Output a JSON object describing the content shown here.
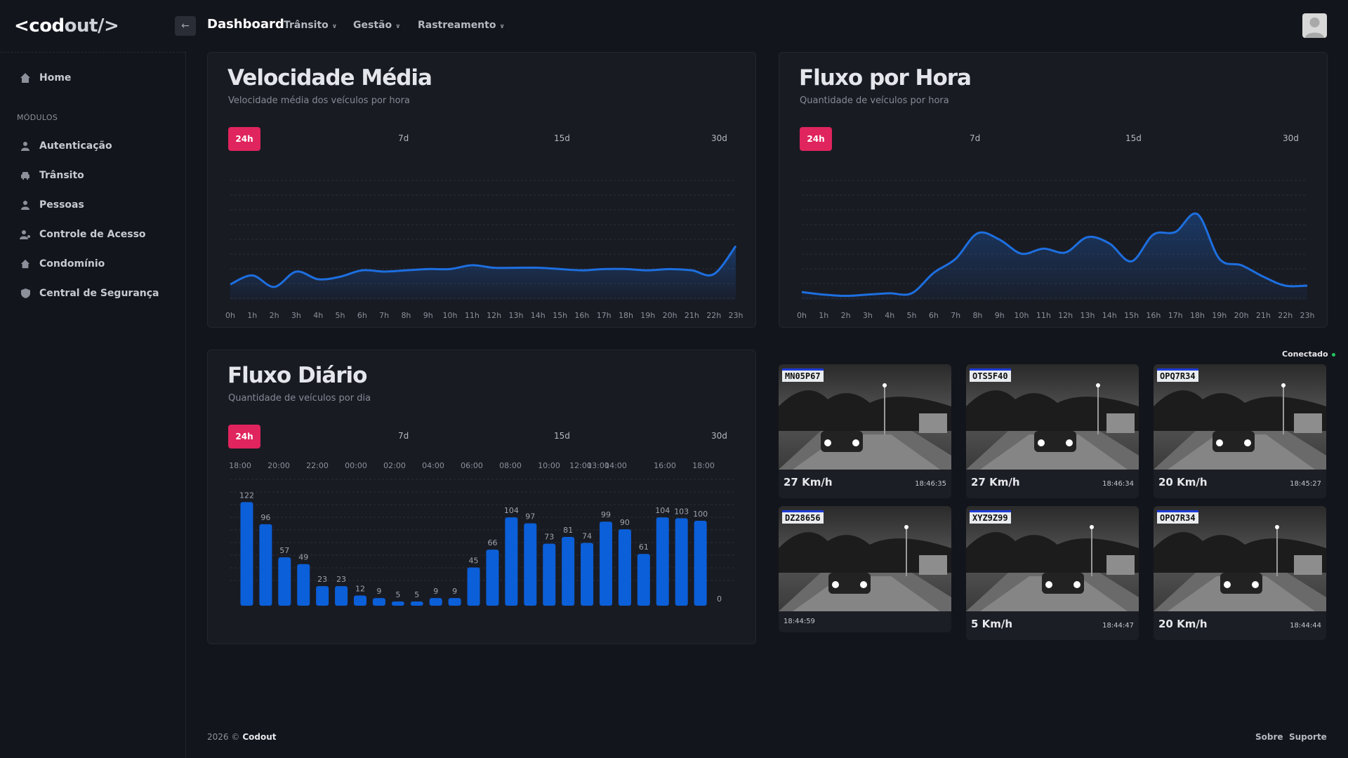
{
  "brand": {
    "logo_left": "<cod",
    "logo_right": "out/>"
  },
  "header": {
    "back_icon": "arrow-left-icon",
    "title": "Dashboard",
    "nav": [
      "Trânsito",
      "Gestão",
      "Rastreamento"
    ]
  },
  "sidebar": {
    "home": "Home",
    "section_label": "MÓDULOS",
    "items": [
      "Autenticação",
      "Trânsito",
      "Pessoas",
      "Controle de Acesso",
      "Condomínio",
      "Central de Segurança"
    ],
    "icons": [
      "user-icon",
      "car-icon",
      "person-icon",
      "user-key-icon",
      "home-icon",
      "shield-icon"
    ]
  },
  "ranges": [
    "24h",
    "7d",
    "15d",
    "30d"
  ],
  "velocidade": {
    "title": "Velocidade Média",
    "subtitle": "Velocidade média dos veículos por hora"
  },
  "fluxo_hora": {
    "title": "Fluxo por Hora",
    "subtitle": "Quantidade de veículos por hora"
  },
  "fluxo_diario": {
    "title": "Fluxo Diário",
    "subtitle": "Quantidade de veículos por dia",
    "zero_label": "0"
  },
  "chart_data": [
    {
      "type": "area",
      "title": "Velocidade Média",
      "x": [
        "0h",
        "1h",
        "2h",
        "3h",
        "4h",
        "5h",
        "6h",
        "7h",
        "8h",
        "9h",
        "10h",
        "11h",
        "12h",
        "13h",
        "14h",
        "15h",
        "16h",
        "17h",
        "18h",
        "19h",
        "20h",
        "21h",
        "22h",
        "23h"
      ],
      "values": [
        12,
        19,
        10,
        22,
        16,
        18,
        23,
        22,
        23,
        24,
        24,
        27,
        25,
        25,
        25,
        24,
        23,
        24,
        24,
        23,
        24,
        23,
        20,
        42
      ],
      "ylim": [
        0,
        100
      ],
      "color": "#1d6fe0"
    },
    {
      "type": "area",
      "title": "Fluxo por Hora",
      "x": [
        "0h",
        "1h",
        "2h",
        "3h",
        "4h",
        "5h",
        "6h",
        "7h",
        "8h",
        "9h",
        "10h",
        "11h",
        "12h",
        "13h",
        "14h",
        "15h",
        "16h",
        "17h",
        "18h",
        "19h",
        "20h",
        "21h",
        "22h",
        "23h"
      ],
      "values": [
        6,
        4,
        3,
        4,
        5,
        5,
        21,
        32,
        52,
        47,
        36,
        40,
        37,
        49,
        44,
        30,
        51,
        53,
        67,
        32,
        27,
        18,
        11,
        11
      ],
      "ylim": [
        0,
        100
      ],
      "color": "#1d6fe0"
    },
    {
      "type": "bar",
      "title": "Fluxo Diário",
      "tick_labels": [
        "18:00",
        "20:00",
        "22:00",
        "00:00",
        "02:00",
        "04:00",
        "06:00",
        "08:00",
        "10:00",
        "12:00",
        "13:00",
        "14:00",
        "16:00",
        "18:00"
      ],
      "values": [
        122,
        96,
        57,
        49,
        23,
        23,
        12,
        9,
        5,
        5,
        9,
        9,
        45,
        66,
        104,
        97,
        73,
        81,
        74,
        99,
        90,
        61,
        104,
        103,
        100,
        0
      ],
      "ylim": [
        0,
        200
      ],
      "color": "#0b5fd8"
    }
  ],
  "connection": {
    "label": "Conectado"
  },
  "cameras": [
    {
      "plate": "MN05P67",
      "speed": "27 Km/h",
      "time": "18:46:35"
    },
    {
      "plate": "OTS5F40",
      "speed": "27 Km/h",
      "time": "18:46:34"
    },
    {
      "plate": "OPQ7R34",
      "speed": "20 Km/h",
      "time": "18:45:27"
    },
    {
      "plate": "DZ28656",
      "speed": "",
      "time": "18:44:59"
    },
    {
      "plate": "XYZ9Z99",
      "speed": "5 Km/h",
      "time": "18:44:47"
    },
    {
      "plate": "OPQ7R34",
      "speed": "20 Km/h",
      "time": "18:44:44"
    }
  ],
  "footer": {
    "copyright": "2026 ©",
    "company": "Codout",
    "links": [
      "Sobre",
      "Suporte"
    ]
  }
}
